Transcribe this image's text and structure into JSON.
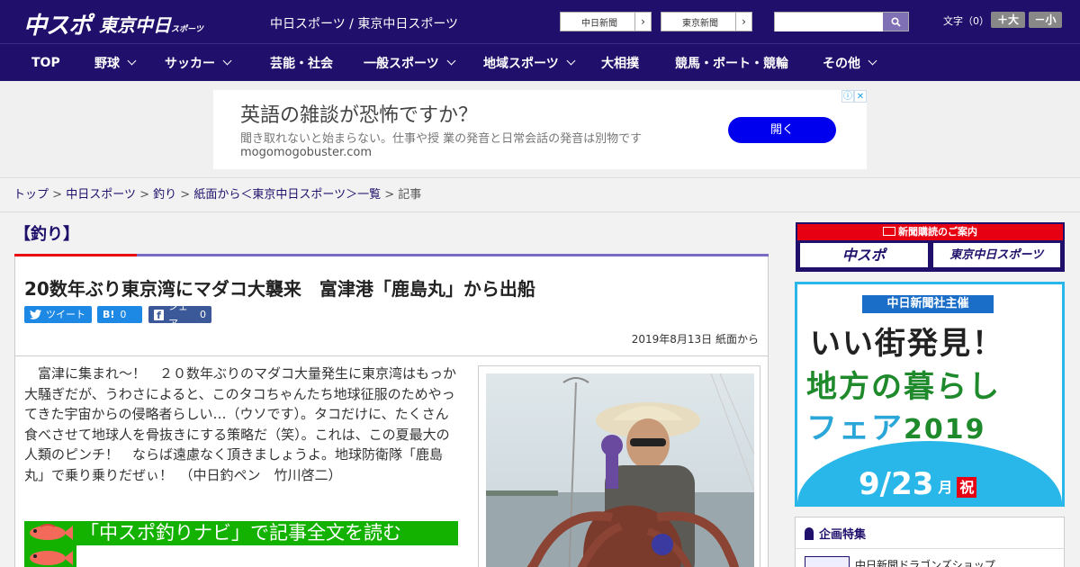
{
  "header": {
    "logo_main": "中スポ",
    "logo_tokyo": "東京中日",
    "logo_tokyo_small": "スポーツ",
    "site_title": "中日スポーツ / 東京中日スポーツ",
    "ext_links": [
      {
        "label": "中日新聞",
        "arrow": "›"
      },
      {
        "label": "東京新聞",
        "arrow": "›"
      }
    ],
    "search": {
      "placeholder": ""
    },
    "font_size_label": "文字（0）",
    "font_plus": "＋大",
    "font_minus": "－小"
  },
  "nav": {
    "items": [
      {
        "label": "TOP",
        "has_dropdown": false
      },
      {
        "label": "野球",
        "has_dropdown": true
      },
      {
        "label": "サッカー",
        "has_dropdown": true
      },
      {
        "label": "芸能・社会",
        "has_dropdown": false
      },
      {
        "label": "一般スポーツ",
        "has_dropdown": true
      },
      {
        "label": "地域スポーツ",
        "has_dropdown": true
      },
      {
        "label": "大相撲",
        "has_dropdown": false
      },
      {
        "label": "競馬・ボート・競輪",
        "has_dropdown": false
      },
      {
        "label": "その他",
        "has_dropdown": true
      }
    ]
  },
  "ad": {
    "title": "英語の雑談が恐怖ですか？",
    "description": "聞き取れないと始まらない。仕事や授 業の発音と日常会話の発音は別物です",
    "url": "mogomogobuster.com",
    "button": "開く",
    "info_icon": "ⓘ",
    "close_icon": "✕"
  },
  "breadcrumb": {
    "items": [
      "トップ",
      "中日スポーツ",
      "釣り",
      "紙面から＜東京中日スポーツ＞一覧"
    ],
    "separator": ">",
    "current": "記事"
  },
  "article": {
    "category": "【釣り】",
    "headline": "20数年ぶり東京湾にマダコ大襲来　富津港「鹿島丸」から出船",
    "share": {
      "tweet": "ツイート",
      "hatena": "B!",
      "hatena_count": "0",
      "facebook": "シェア",
      "facebook_count": "0"
    },
    "date": "2019年8月13日 紙面から",
    "body": "富津に集まれ～！　２０数年ぶりのマダコ大量発生に東京湾はもっか大騒ぎだが、うわさによると、このタコちゃんたち地球征服のためやってきた宇宙からの侵略者らしい…（ウソです）。タコだけに、たくさん食べさせて地球人を骨抜きにする策略だ（笑）。これは、この夏最大の人類のピンチ！　ならば遠慮なく頂きましょうよ。地球防衛隊「鹿島丸」で乗り乗りだぜぃ！　（中日釣ペン　竹川啓二）",
    "navi_link": "「中スポ釣りナビ」で記事全文を読む"
  },
  "sidebar": {
    "subscribe_header": "新聞購読のご案内",
    "subscribe_logos": [
      "中スポ",
      "東京中日スポーツ"
    ],
    "banner": {
      "top": "中日新聞社主催",
      "line1": "いい街発見！",
      "line2": "地方の暮らし",
      "line3": "フェア",
      "year": "2019",
      "date": "9/23",
      "day": "月",
      "holiday": "祝"
    },
    "feature_title": "企画特集",
    "feature_item": "中日新聞ドラゴンズショップ"
  },
  "colors": {
    "brand_navy": "#20106b",
    "accent_red": "#e60012",
    "accent_purple": "#7a6ac2",
    "navi_green": "#14b200",
    "twitter_blue": "#1e88e5",
    "ad_button": "#0000ee"
  }
}
